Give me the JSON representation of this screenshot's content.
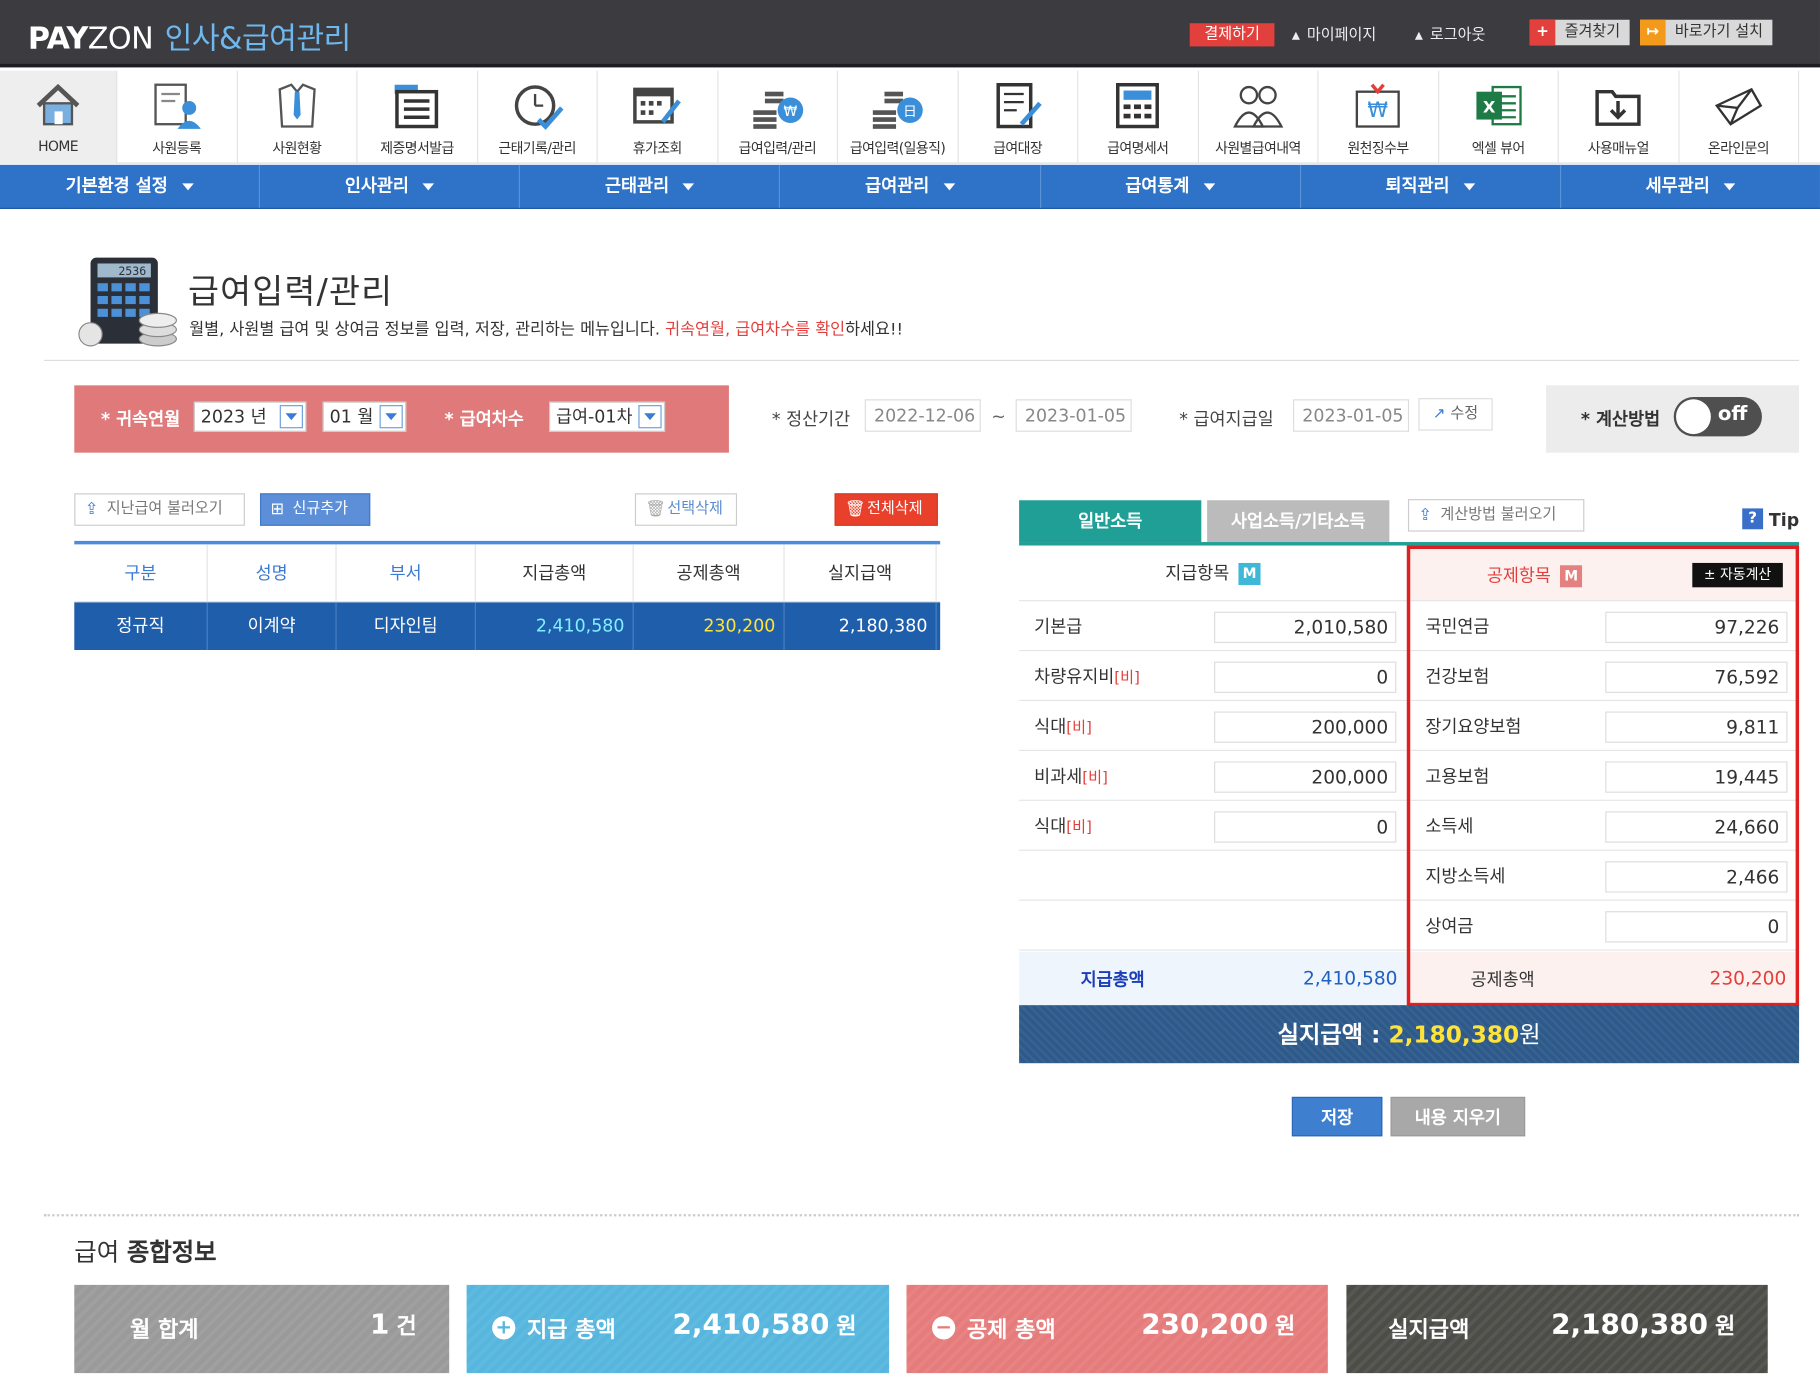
{
  "brand": {
    "name_bold": "PAY",
    "name_light": "ZON",
    "subtitle": "인사&급여관리"
  },
  "topbar": {
    "pay_button": "결제하기",
    "mypage": "마이페이지",
    "logout": "로그아웃",
    "bookmark": "즐겨찾기",
    "shortcut": "바로가기 설치"
  },
  "icon_menu": [
    {
      "label": "HOME",
      "icon": "home-icon"
    },
    {
      "label": "사원등록",
      "icon": "employee-register-icon"
    },
    {
      "label": "사원현황",
      "icon": "employee-status-icon"
    },
    {
      "label": "제증명서발급",
      "icon": "certificate-icon"
    },
    {
      "label": "근태기록/관리",
      "icon": "attendance-clock-icon"
    },
    {
      "label": "휴가조회",
      "icon": "vacation-calendar-icon"
    },
    {
      "label": "급여입력/관리",
      "icon": "payroll-input-icon"
    },
    {
      "label": "급여입력(일용직)",
      "icon": "payroll-daily-icon"
    },
    {
      "label": "급여대장",
      "icon": "payroll-ledger-icon"
    },
    {
      "label": "급여명세서",
      "icon": "payslip-icon"
    },
    {
      "label": "사원별급여내역",
      "icon": "employee-pay-history-icon"
    },
    {
      "label": "원천징수부",
      "icon": "withholding-icon"
    },
    {
      "label": "엑셀 뷰어",
      "icon": "excel-icon"
    },
    {
      "label": "사용매뉴얼",
      "icon": "manual-download-icon"
    },
    {
      "label": "온라인문의",
      "icon": "online-inquiry-icon"
    }
  ],
  "nav": [
    "기본환경 설정",
    "인사관리",
    "근태관리",
    "급여관리",
    "급여통계",
    "퇴직관리",
    "세무관리"
  ],
  "page": {
    "title": "급여입력/관리",
    "desc_prefix": "월별, 사원별 급여 및 상여금 정보를 입력, 저장, 관리하는 메뉴입니다. ",
    "desc_highlight": "귀속연월, 급여차수를 확인",
    "desc_suffix": "하세요!!"
  },
  "filters": {
    "attribution_label": "* 귀속연월",
    "year": "2023 년",
    "month": "01 월",
    "round_label": "* 급여차수",
    "round": "급여-01차",
    "period_label": "* 정산기간",
    "period_start": "2022-12-06",
    "period_sep": "~",
    "period_end": "2023-01-05",
    "paydate_label": "* 급여지급일",
    "paydate": "2023-01-05",
    "edit": "수정",
    "calc_label": "* 계산방법",
    "calc_toggle": "off"
  },
  "left_buttons": {
    "load_prev": "지난급여 불러오기",
    "add_new": "신규추가",
    "delete_sel": "선택삭제",
    "delete_all": "전체삭제"
  },
  "table": {
    "headers": [
      "구분",
      "성명",
      "부서",
      "지급총액",
      "공제총액",
      "실지급액"
    ],
    "rows": [
      {
        "type": "정규직",
        "name": "이계약",
        "dept": "디자인팀",
        "pay": "2,410,580",
        "deduct": "230,200",
        "net": "2,180,380"
      }
    ]
  },
  "tabs": {
    "general": "일반소득",
    "business": "사업소득/기타소득",
    "load_calc": "계산방법 불러오기",
    "tip": "Tip"
  },
  "pay_items": {
    "header": "지급항목",
    "badge": "M",
    "rows": [
      {
        "label": "기본급",
        "tag": "",
        "value": "2,010,580"
      },
      {
        "label": "차량유지비",
        "tag": "[비]",
        "value": "0"
      },
      {
        "label": "식대",
        "tag": "[비]",
        "value": "200,000"
      },
      {
        "label": "비과세",
        "tag": "[비]",
        "value": "200,000"
      },
      {
        "label": "식대",
        "tag": "[비]",
        "value": "0"
      }
    ],
    "total_label": "지급총액",
    "total_value": "2,410,580"
  },
  "deduct_items": {
    "header": "공제항목",
    "badge": "M",
    "auto_calc": "± 자동계산",
    "rows": [
      {
        "label": "국민연금",
        "value": "97,226"
      },
      {
        "label": "건강보험",
        "value": "76,592"
      },
      {
        "label": "장기요양보험",
        "value": "9,811"
      },
      {
        "label": "고용보험",
        "value": "19,445"
      },
      {
        "label": "소득세",
        "value": "24,660"
      },
      {
        "label": "지방소득세",
        "value": "2,466"
      },
      {
        "label": "상여금",
        "value": "0"
      }
    ],
    "total_label": "공제총액",
    "total_value": "230,200"
  },
  "net": {
    "label": "실지급액 : ",
    "value": "2,180,380",
    "unit": "원"
  },
  "actions": {
    "save": "저장",
    "clear": "내용 지우기"
  },
  "summary": {
    "title_light": "급여",
    "title_bold": "종합정보",
    "cards": [
      {
        "label": "월 합계",
        "value": "1",
        "unit": "건"
      },
      {
        "label": "지급 총액",
        "value": "2,410,580",
        "unit": "원"
      },
      {
        "label": "공제 총액",
        "value": "230,200",
        "unit": "원"
      },
      {
        "label": "실지급액",
        "value": "2,180,380",
        "unit": "원"
      }
    ]
  },
  "colors": {
    "primary_blue": "#2f73c9",
    "teal": "#1f9f96",
    "red_filter": "#e07a7a",
    "highlight_red": "#e02020"
  }
}
